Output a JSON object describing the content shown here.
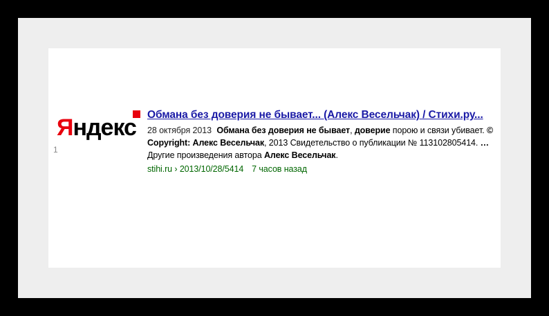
{
  "logo": {
    "first_letter": "Я",
    "rest": "ндекс"
  },
  "result": {
    "title": "Обмана без доверия не бывает... (Алекс Весельчак) / Стихи.ру...",
    "date": "28 октября 2013",
    "snippet_parts": [
      "Обмана без доверия не бывает",
      ", ",
      "доверие",
      " порою и связи убивает. ",
      "© Copyright: Алекс Весельчак",
      ", 2013 Свидетельство о публикации № 113102805414. ",
      "…",
      " Другие произведения автора ",
      "Алекс Весельчак",
      "."
    ],
    "url": "stihi.ru › 2013/10/28/5414",
    "age": "7 часов назад"
  },
  "page_number": "1",
  "colors": {
    "logo_red": "#e8000d",
    "link_blue": "#1a1aa6",
    "url_green": "#006600",
    "frame_gray": "#eeeeee",
    "background": "#000000"
  }
}
